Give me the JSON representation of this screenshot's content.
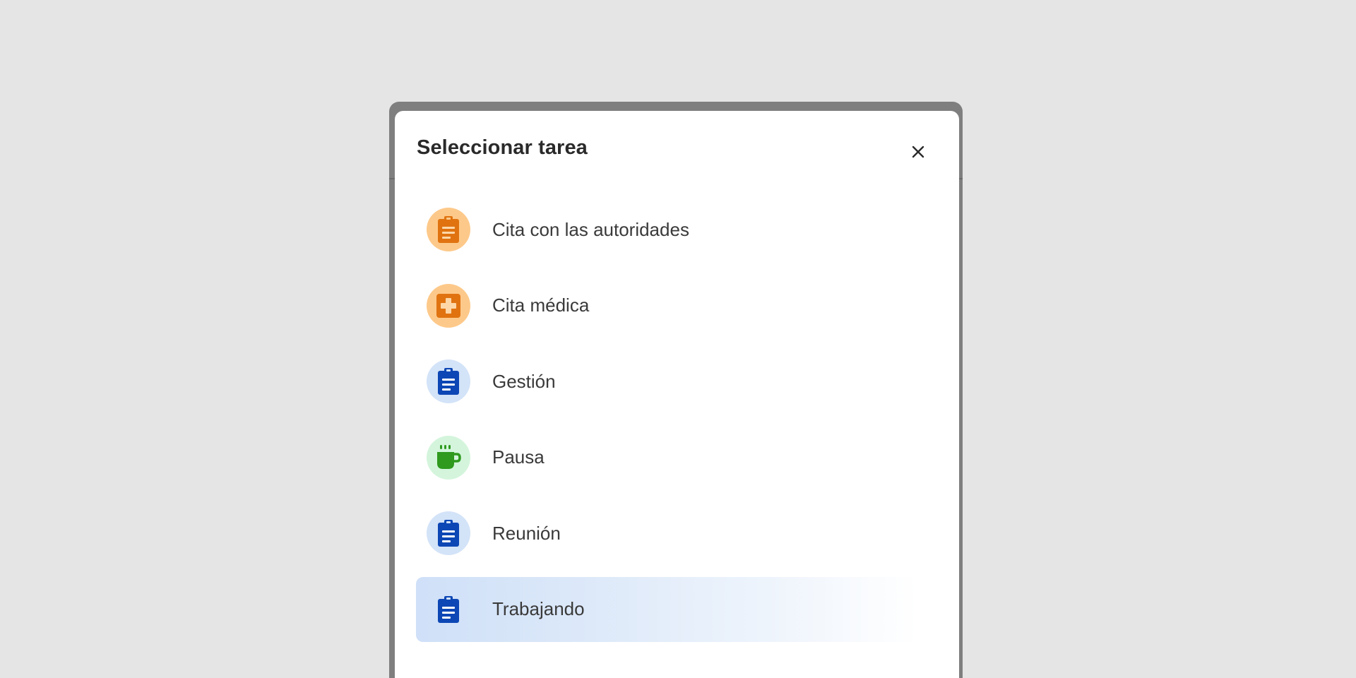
{
  "modal": {
    "title": "Seleccionar tarea",
    "close_icon": "close-icon"
  },
  "tasks": [
    {
      "label": "Cita con las autoridades",
      "icon": "clipboard-icon",
      "icon_color": "#e07310",
      "bg_color": "#fdc98a",
      "selected": false
    },
    {
      "label": "Cita médica",
      "icon": "medical-cross-icon",
      "icon_color": "#e07310",
      "bg_color": "#fdc98a",
      "selected": false
    },
    {
      "label": "Gestión",
      "icon": "clipboard-icon",
      "icon_color": "#0d47b5",
      "bg_color": "#d3e3f8",
      "selected": false
    },
    {
      "label": "Pausa",
      "icon": "coffee-cup-icon",
      "icon_color": "#2f9a1e",
      "bg_color": "#d4f5dc",
      "selected": false
    },
    {
      "label": "Reunión",
      "icon": "clipboard-icon",
      "icon_color": "#0d47b5",
      "bg_color": "#d3e3f8",
      "selected": false
    },
    {
      "label": "Trabajando",
      "icon": "clipboard-icon",
      "icon_color": "#0d47b5",
      "bg_color": "transparent",
      "selected": true
    }
  ]
}
